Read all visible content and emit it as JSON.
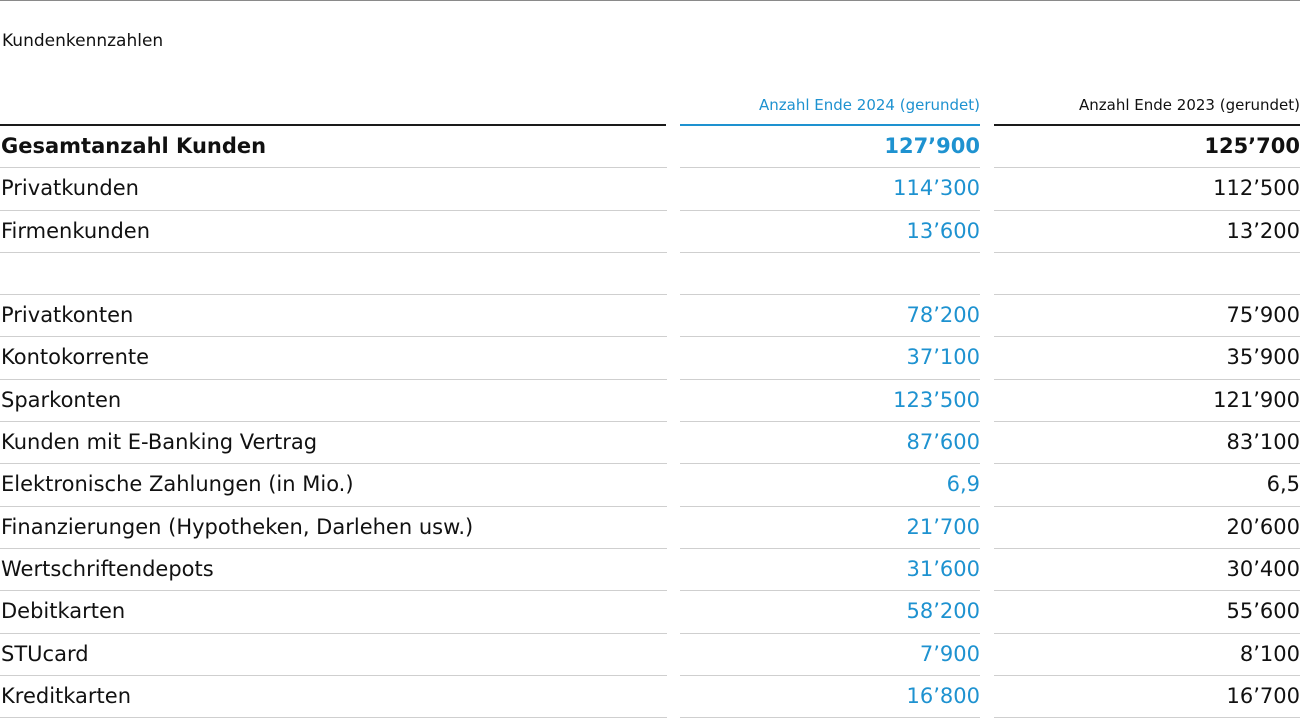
{
  "title": "Kundenkennzahlen",
  "columns": {
    "year_2024": "Anzahl Ende 2024 (gerundet)",
    "year_2023": "Anzahl Ende 2023 (gerundet)"
  },
  "colors": {
    "accent": "#1e92d0",
    "text": "#111111",
    "rule": "#cfcfcf"
  },
  "rows": [
    {
      "label": "Gesamtanzahl Kunden",
      "v2024": "127’900",
      "v2023": "125’700",
      "bold": true
    },
    {
      "label": "Privatkunden",
      "v2024": "114’300",
      "v2023": "112’500"
    },
    {
      "label": "Firmenkunden",
      "v2024": "13’600",
      "v2023": "13’200"
    },
    {
      "label": "",
      "v2024": "",
      "v2023": ""
    },
    {
      "label": "Privatkonten",
      "v2024": "78’200",
      "v2023": "75’900"
    },
    {
      "label": "Kontokorrente",
      "v2024": "37’100",
      "v2023": "35’900"
    },
    {
      "label": "Sparkonten",
      "v2024": "123’500",
      "v2023": "121’900"
    },
    {
      "label": "Kunden mit E-Banking Vertrag",
      "v2024": "87’600",
      "v2023": "83’100"
    },
    {
      "label": "Elektronische Zahlungen (in Mio.)",
      "v2024": "6,9",
      "v2023": "6,5"
    },
    {
      "label": "Finanzierungen (Hypotheken, Darlehen usw.)",
      "v2024": "21’700",
      "v2023": "20’600"
    },
    {
      "label": "Wertschriftendepots",
      "v2024": "31’600",
      "v2023": "30’400"
    },
    {
      "label": "Debitkarten",
      "v2024": "58’200",
      "v2023": "55’600"
    },
    {
      "label": "STUcard",
      "v2024": "7’900",
      "v2023": "8’100"
    },
    {
      "label": "Kreditkarten",
      "v2024": "16’800",
      "v2023": "16’700"
    }
  ]
}
